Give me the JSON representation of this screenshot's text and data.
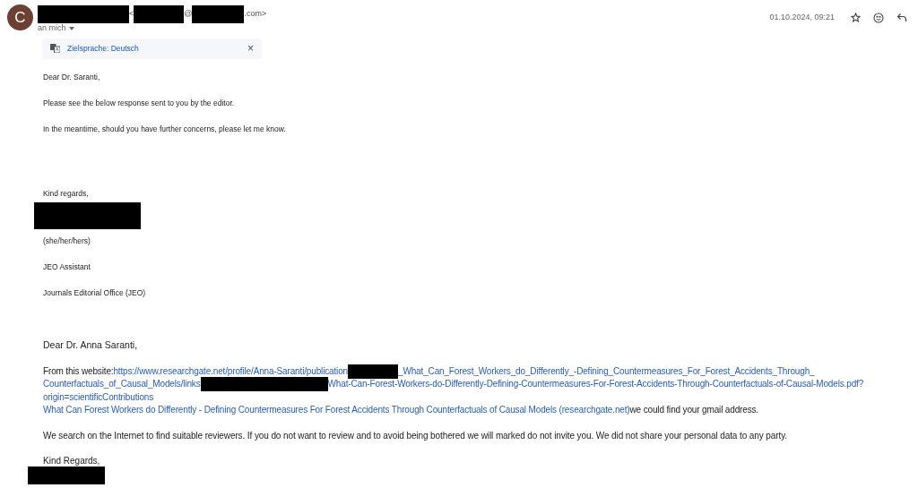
{
  "header": {
    "avatar_letter": "C",
    "sender": [
      {
        "kind": "redacted"
      },
      {
        "kind": "text",
        "text": "<"
      },
      {
        "kind": "redacted"
      },
      {
        "kind": "text",
        "text": "@"
      },
      {
        "kind": "redacted"
      },
      {
        "kind": "text",
        "text": ".com>"
      }
    ],
    "recipient": "an mich",
    "date": "01.10.2024, 09:21"
  },
  "translation_bar": {
    "label": "Zielsprache: Deutsch",
    "close": "×"
  },
  "body1": [
    "Dear Dr. Saranti,",
    "Please see the below response sent to you by the editor.",
    "In the meantime, should you have further concerns, please let me know."
  ],
  "closing1": "Kind regards,",
  "signature": [
    "(she/her/hers)",
    "JEO Assistant",
    "Journals Editorial Office (JEO)"
  ],
  "greeting2": "Dear Dr. Anna Saranti,",
  "source_lines": [
    [
      {
        "kind": "text",
        "text": "From this website:"
      },
      {
        "kind": "link",
        "text": "https://www.researchgate.net/profile/Anna-Saranti/publication"
      },
      {
        "kind": "redacted"
      },
      {
        "kind": "link",
        "text": "_What_Can_Forest_Workers_do_Differently_-Defining_Countermeasures_For_Forest_Accidents_Through_"
      }
    ],
    [
      {
        "kind": "link",
        "text": "Counterfactuals_of_Causal_Models/links"
      },
      {
        "kind": "redacted"
      },
      {
        "kind": "link",
        "text": "What-Can-Forest-Workers-do-Differently-Defining-Countermeasures-For-Forest-Accidents-Through-Counterfactuals-of-Causal-Models.pdf?"
      }
    ],
    [
      {
        "kind": "link",
        "text": "origin=scientificContributions"
      }
    ],
    [
      {
        "kind": "link",
        "text": "What Can Forest Workers do Differently - Defining Countermeasures For Forest Accidents Through Counterfactuals of Causal Models (researchgate.net)"
      },
      {
        "kind": "text",
        "text": "we could find your gmail address."
      }
    ]
  ],
  "paragraph": "We search on the Internet to find suitable reviewers. If you do not want to review and to avoid being bothered we will marked do not invite you. We did not share your personal data to any party.",
  "closing2": "Kind Regards,"
}
